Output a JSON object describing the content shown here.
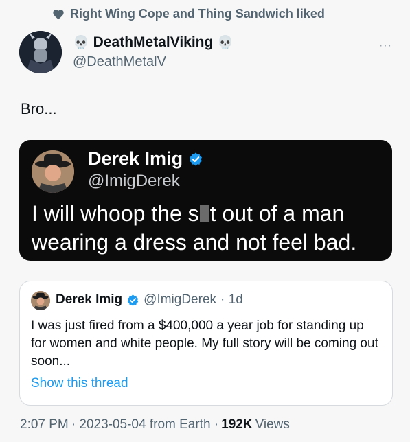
{
  "social_context": {
    "text": "Right Wing Cope and Thing Sandwich liked",
    "icon": "heart-icon"
  },
  "author": {
    "name": "DeathMetalViking",
    "handle": "@DeathMetalV",
    "prefix_emoji": "💀",
    "suffix_emoji": "💀"
  },
  "more_icon": "···",
  "tweet_text": "Bro...",
  "embedded_image": {
    "name": "Derek Imig",
    "handle": "@ImigDerek",
    "text_before": "I will whoop the s",
    "text_after": "t out of a man wearing a dress and not feel bad."
  },
  "quoted_tweet": {
    "name": "Derek Imig",
    "handle": "@ImigDerek",
    "time": "· 1d",
    "text": "I was just fired from a $400,000 a year job for standing up for women and white people.  My full story will be coming out soon...",
    "link": "Show this thread"
  },
  "footer": {
    "time": "2:07 PM",
    "date": "· 2023-05-04 from Earth ·",
    "views_count": "192K",
    "views_label": "Views"
  },
  "colors": {
    "link": "#1d9bf0",
    "verified": "#1d9bf0",
    "muted": "#536471",
    "dark_card": "#0b0b0b"
  }
}
